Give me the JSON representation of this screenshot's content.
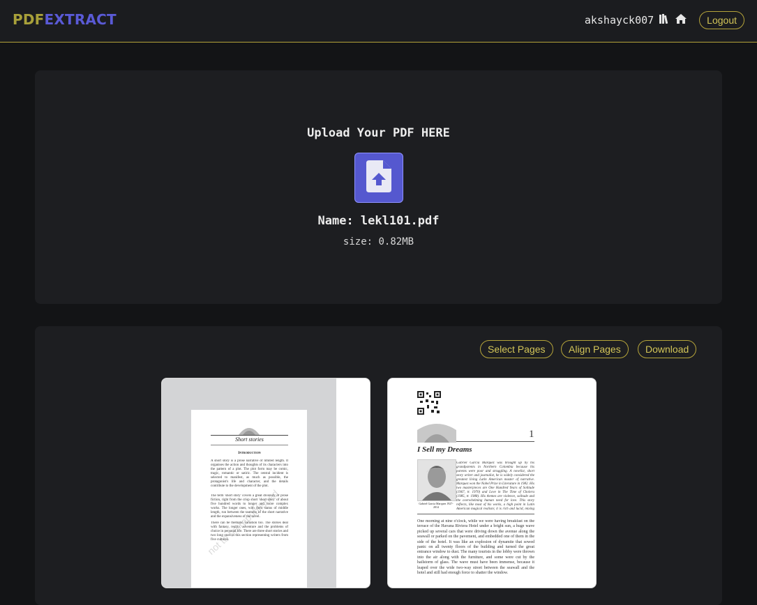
{
  "nav": {
    "logo_part1": "PDF",
    "logo_part2": "EXTRACT",
    "username": "akshayck007",
    "icons": [
      "books-icon",
      "home-icon"
    ],
    "logout_label": "Logout"
  },
  "upload": {
    "title": "Upload Your PDF HERE",
    "file_name": "Name: lekl101.pdf",
    "file_size": "size: 0.82MB",
    "icon": "file-upload-icon"
  },
  "pages_toolbar": {
    "select_label": "Select Pages",
    "align_label": "Align Pages",
    "download_label": "Download"
  },
  "pages": [
    {
      "heading": "Short stories",
      "subheading": "Introduction",
      "para1": "A short story is a prose narrative of limited length. It organises the action and thoughts of its characters into the pattern of a plot. The plot form may be comic, tragic, romantic or satiric. The central incident is selected to manifest, as much as possible, the protagonist's life and character, and the details contribute to the development of the plot.",
      "para2": "The term 'short story' covers a great diversity of prose fiction, right from the crisp short 'short story' of about five hundred words to longer and more complex works. The longer ones, with their status of middle length, run between the tautness of the short narrative and the expansiveness of the novel.",
      "para3": "There can be thematic variation too. The stories deal with fantasy, reality, adventure and the problems of choice in personal life. There are three short stories and two long ones in this section representing writers from five cultures.",
      "watermark": "not to be republished"
    },
    {
      "chapter_number": "1",
      "title": "I Sell my Dreams",
      "intro": "Gabriel Garcia Marquez was brought up by his grandparents in Northern Colombia because his parents were poor and struggling. A novelist, short story writer and journalist, he is widely considered the greatest living Latin American master of narrative. Marquez won the Nobel Prize in Literature in 1982. His two masterpieces are One Hundred Years of Solitude (1967, tr. 1970) and Love in The Time of Cholera (1985, tr. 1988). His themes are violence, solitude and the overwhelming human need for love. This story reflects, like most of his works, a high point in Latin American magical realism; it is rich and lucid, mixing reality with fantasy.",
      "portrait_caption": "Gabriel Garcia Marquez 1927-2014",
      "body": "One morning at nine o'clock, while we were having breakfast on the terrace of the Havana Riviera Hotel under a bright sun, a huge wave picked up several cars that were driving down the avenue along the seawall or parked on the pavement, and embedded one of them in the side of the hotel. It was like an explosion of dynamite that sowed panic on all twenty floors of the building and turned the great entrance window to dust. The many tourists in the lobby were thrown into the air along with the furniture, and some were cut by the hailstorm of glass. The wave must have been immense, because it leaped over the wide two-way street between the seawall and the hotel and still had enough force to shatter the window."
    }
  ]
}
